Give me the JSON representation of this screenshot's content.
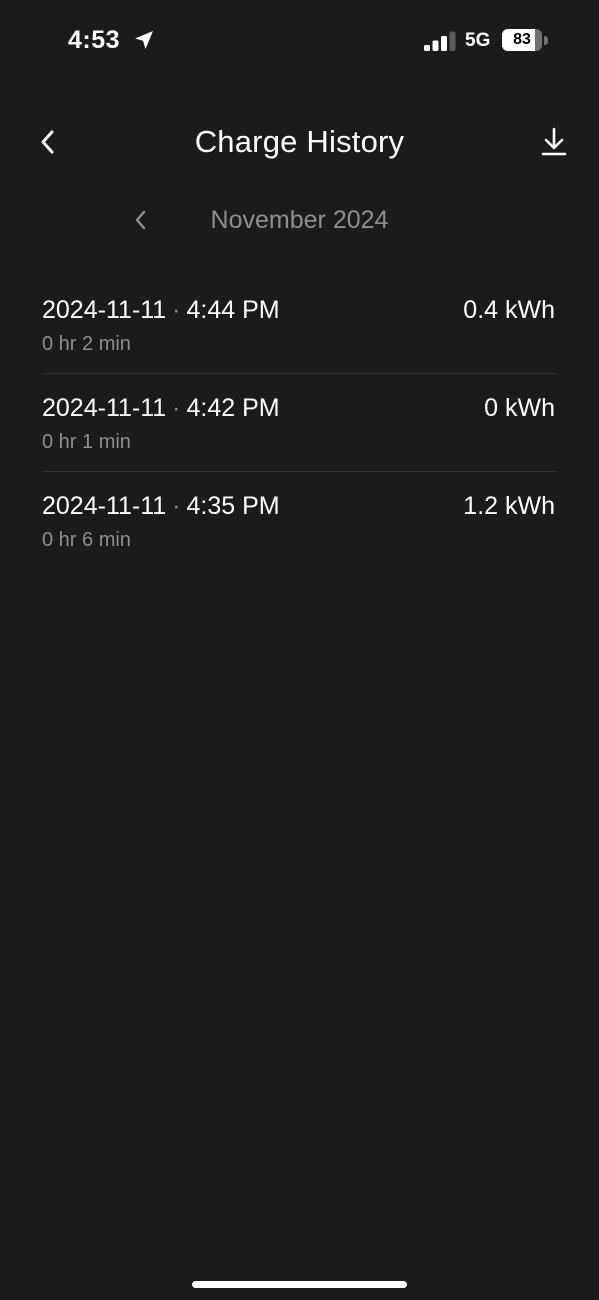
{
  "status_bar": {
    "time": "4:53",
    "network": "5G",
    "battery_percent": "83",
    "battery_level": 0.83,
    "signal_bars_active": 3,
    "signal_bars_total": 4,
    "location_icon": "location-arrow-icon",
    "signal_icon": "cellular-signal-icon"
  },
  "header": {
    "title": "Charge History",
    "back_icon": "chevron-left-icon",
    "download_icon": "download-icon"
  },
  "month_nav": {
    "label": "November 2024",
    "prev_icon": "chevron-left-icon"
  },
  "charges": [
    {
      "date": "2024-11-11",
      "separator": "·",
      "time": "4:44 PM",
      "duration": "0 hr 2 min",
      "energy": "0.4 kWh"
    },
    {
      "date": "2024-11-11",
      "separator": "·",
      "time": "4:42 PM",
      "duration": "0 hr 1 min",
      "energy": "0 kWh"
    },
    {
      "date": "2024-11-11",
      "separator": "·",
      "time": "4:35 PM",
      "duration": "0 hr 6 min",
      "energy": "1.2 kWh"
    }
  ],
  "colors": {
    "background": "#1a1b1d",
    "text_primary": "#ffffff",
    "text_secondary": "#8e8e93",
    "divider": "#323336"
  }
}
